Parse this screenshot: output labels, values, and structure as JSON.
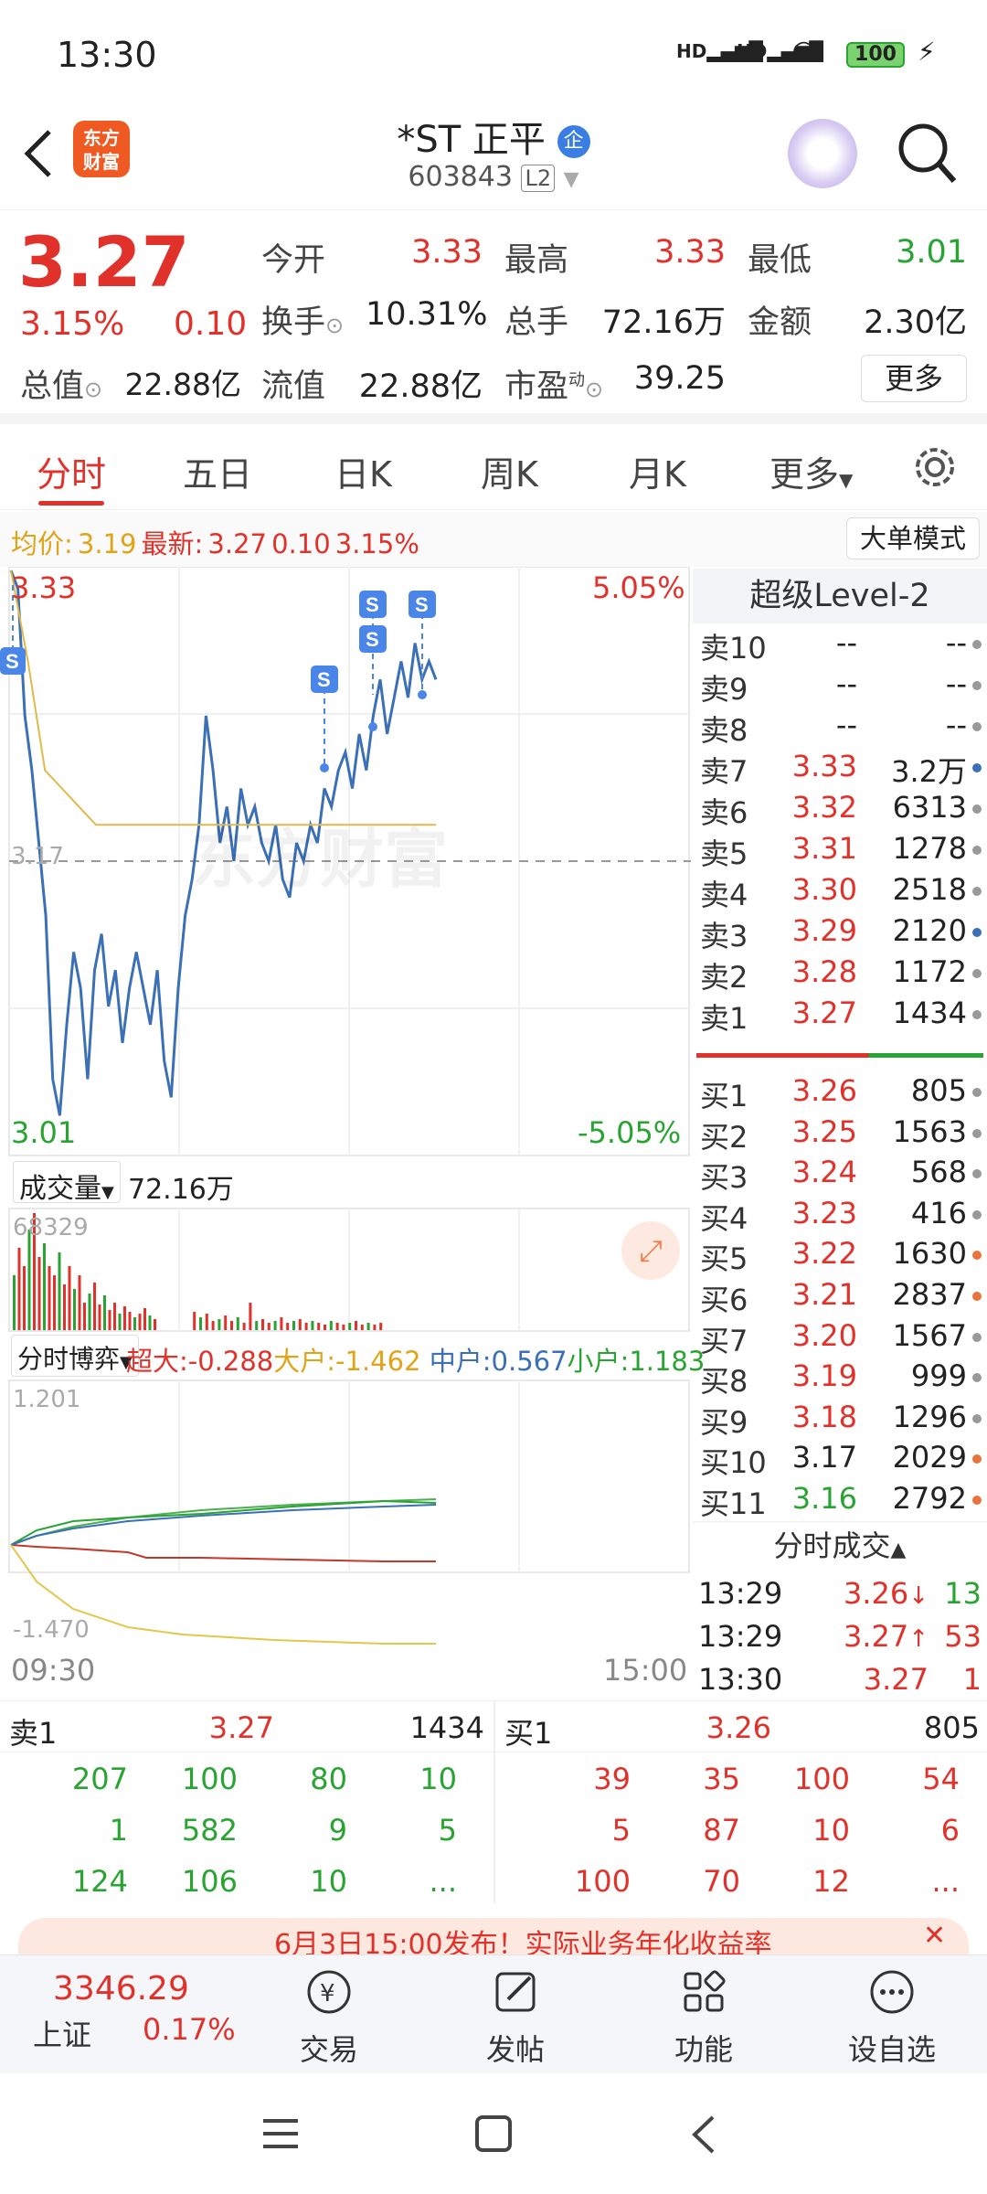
{
  "status_bar": {
    "time": "13:30",
    "battery": "100"
  },
  "header": {
    "logo_text": "东方财富",
    "stock_name": "*ST 正平",
    "badge": "企",
    "code": "603843",
    "level": "L2"
  },
  "quote": {
    "price": "3.27",
    "change_pct": "3.15%",
    "change": "0.10",
    "open_label": "今开",
    "open": "3.33",
    "high_label": "最高",
    "high": "3.33",
    "low_label": "最低",
    "low": "3.01",
    "turnover_label": "换手",
    "turnover": "10.31%",
    "volume_label": "总手",
    "volume": "72.16万",
    "amount_label": "金额",
    "amount": "2.30亿",
    "mktcap_label": "总值",
    "mktcap": "22.88亿",
    "float_label": "流值",
    "float": "22.88亿",
    "pe_label": "市盈",
    "pe_sup": "动",
    "pe": "39.25",
    "more_btn": "更多"
  },
  "tabs": [
    "分时",
    "五日",
    "日K",
    "周K",
    "月K",
    "更多"
  ],
  "infoline": {
    "avg_label": "均价:",
    "avg": "3.19",
    "latest_label": "最新:",
    "latest": "3.27",
    "chg": "0.10",
    "pct": "3.15%",
    "mode_btn": "大单模式"
  },
  "chart": {
    "top_price": "3.33",
    "top_pct": "5.05%",
    "mid_price": "3.17",
    "bottom_price": "3.01",
    "bottom_pct": "-5.05%",
    "watermark": "东方财富",
    "volume_label": "成交量",
    "volume_total": "72.16万",
    "volume_max": "68329",
    "game_label": "分时博弈",
    "super_large": "超大:-0.288",
    "large": "大户:-1.462",
    "medium": "中户:0.567",
    "small": "小户:1.183",
    "game_max": "1.201",
    "game_min": "-1.470",
    "time_start": "09:30",
    "time_end": "15:00",
    "marker": "S"
  },
  "book": {
    "title": "超级Level-2",
    "asks": [
      {
        "label": "卖10",
        "price": "--",
        "vol": "--",
        "dot": "#999"
      },
      {
        "label": "卖9",
        "price": "--",
        "vol": "--",
        "dot": "#999"
      },
      {
        "label": "卖8",
        "price": "--",
        "vol": "--",
        "dot": "#999"
      },
      {
        "label": "卖7",
        "price": "3.33",
        "vol": "3.2万",
        "dot": "#3b6fb6"
      },
      {
        "label": "卖6",
        "price": "3.32",
        "vol": "6313",
        "dot": "#999"
      },
      {
        "label": "卖5",
        "price": "3.31",
        "vol": "1278",
        "dot": "#999"
      },
      {
        "label": "卖4",
        "price": "3.30",
        "vol": "2518",
        "dot": "#999"
      },
      {
        "label": "卖3",
        "price": "3.29",
        "vol": "2120",
        "dot": "#3b6fb6"
      },
      {
        "label": "卖2",
        "price": "3.28",
        "vol": "1172",
        "dot": "#999"
      },
      {
        "label": "卖1",
        "price": "3.27",
        "vol": "1434",
        "dot": "#999"
      }
    ],
    "bids": [
      {
        "label": "买1",
        "price": "3.26",
        "vol": "805",
        "dot": "#999",
        "color": "red"
      },
      {
        "label": "买2",
        "price": "3.25",
        "vol": "1563",
        "dot": "#999",
        "color": "red"
      },
      {
        "label": "买3",
        "price": "3.24",
        "vol": "568",
        "dot": "#999",
        "color": "red"
      },
      {
        "label": "买4",
        "price": "3.23",
        "vol": "416",
        "dot": "#999",
        "color": "red"
      },
      {
        "label": "买5",
        "price": "3.22",
        "vol": "1630",
        "dot": "#e8743b",
        "color": "red"
      },
      {
        "label": "买6",
        "price": "3.21",
        "vol": "2837",
        "dot": "#e8743b",
        "color": "red"
      },
      {
        "label": "买7",
        "price": "3.20",
        "vol": "1567",
        "dot": "#999",
        "color": "red"
      },
      {
        "label": "买8",
        "price": "3.19",
        "vol": "999",
        "dot": "#999",
        "color": "red"
      },
      {
        "label": "买9",
        "price": "3.18",
        "vol": "1296",
        "dot": "#999",
        "color": "red"
      },
      {
        "label": "买10",
        "price": "3.17",
        "vol": "2029",
        "dot": "#e8743b",
        "color": "black"
      },
      {
        "label": "买11",
        "price": "3.16",
        "vol": "2792",
        "dot": "#e8743b",
        "color": "green"
      }
    ],
    "trades_title": "分时成交",
    "trades": [
      {
        "time": "13:29",
        "price": "3.26",
        "arrow": "↓",
        "vol": "13",
        "color": "red",
        "vcolor": "green"
      },
      {
        "time": "13:29",
        "price": "3.27",
        "arrow": "↑",
        "vol": "53",
        "color": "red",
        "vcolor": "red"
      },
      {
        "time": "13:30",
        "price": "3.27",
        "arrow": "",
        "vol": "1",
        "color": "red",
        "vcolor": "red"
      }
    ]
  },
  "queue": {
    "ask_label": "卖1",
    "ask_price": "3.27",
    "ask_vol": "1434",
    "bid_label": "买1",
    "bid_price": "3.26",
    "bid_vol": "805",
    "ask_rows": [
      [
        "207",
        "100",
        "80",
        "10"
      ],
      [
        "1",
        "582",
        "9",
        "5"
      ],
      [
        "124",
        "106",
        "10",
        "..."
      ]
    ],
    "bid_rows": [
      [
        "39",
        "35",
        "100",
        "54"
      ],
      [
        "5",
        "87",
        "10",
        "6"
      ],
      [
        "100",
        "70",
        "12",
        "..."
      ]
    ]
  },
  "banner": {
    "text": "6月3日15:00发布！实际业务年化收益率"
  },
  "bottom_nav": {
    "index_value": "3346.29",
    "index_name": "上证",
    "index_pct": "0.17%",
    "trade": "交易",
    "post": "发帖",
    "func": "功能",
    "watch": "设自选"
  },
  "chart_data": {
    "type": "line",
    "title": "",
    "x": [
      "09:30",
      "15:00"
    ],
    "ylim": [
      3.01,
      3.33
    ],
    "series": [
      {
        "name": "",
        "values": [
          3.33,
          3.32,
          3.25,
          3.22,
          3.18,
          3.14,
          3.05,
          3.03,
          3.08,
          3.12,
          3.1,
          3.05,
          3.11,
          3.13,
          3.09,
          3.11,
          3.07,
          3.1,
          3.12,
          3.1,
          3.08,
          3.11,
          3.06,
          3.04,
          3.1,
          3.14,
          3.16,
          3.19,
          3.25,
          3.22,
          3.18,
          3.2,
          3.17,
          3.21,
          3.19,
          3.2,
          3.18,
          3.17,
          3.19,
          3.16,
          3.15,
          3.18,
          3.17,
          3.19,
          3.18,
          3.21,
          3.2,
          3.22,
          3.23,
          3.21,
          3.24,
          3.22,
          3.25,
          3.27,
          3.24,
          3.26,
          3.28,
          3.26,
          3.29,
          3.27,
          3.28,
          3.27
        ]
      },
      {
        "name": "均价",
        "values": [
          3.33,
          3.28,
          3.22,
          3.21,
          3.2,
          3.19,
          3.19,
          3.19,
          3.19,
          3.19,
          3.19,
          3.19,
          3.19,
          3.19,
          3.19,
          3.19,
          3.19,
          3.19,
          3.19,
          3.19,
          3.19,
          3.19,
          3.19,
          3.19,
          3.19,
          3.19
        ]
      }
    ]
  }
}
